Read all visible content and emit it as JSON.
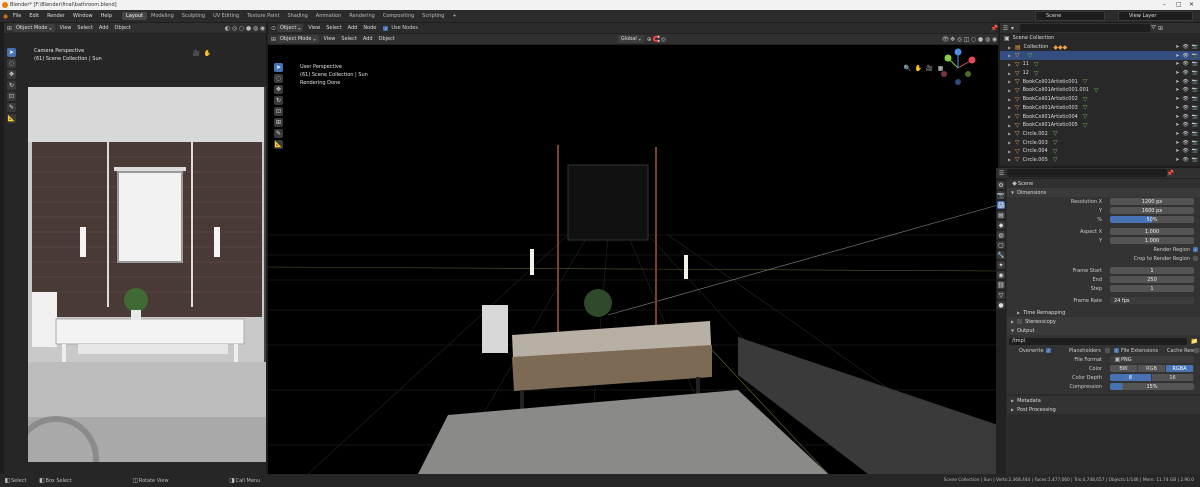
{
  "window": {
    "title": "Blender* [F:\\Blender\\final\\bathroom.blend]"
  },
  "menu": [
    "File",
    "Edit",
    "Render",
    "Window",
    "Help"
  ],
  "workspaces": [
    "Layout",
    "Modeling",
    "Sculpting",
    "UV Editing",
    "Texture Paint",
    "Shading",
    "Animation",
    "Rendering",
    "Compositing",
    "Scripting"
  ],
  "active_workspace": "Layout",
  "scene_selector": {
    "value": "Scene"
  },
  "view_layer_selector": {
    "value": "View Layer"
  },
  "left_view": {
    "mode": "Object Mode",
    "menus": [
      "View",
      "Select",
      "Add",
      "Object"
    ],
    "transform": "Global",
    "overlay_line1": "Camera Perspective",
    "overlay_line2": "(61) Scene Collection | Sun"
  },
  "main_view": {
    "mode": "Object Mode",
    "menus": [
      "View",
      "Select",
      "Add",
      "Object"
    ],
    "transform": "Global",
    "overlay_line1": "User Perspective",
    "overlay_line2": "(61) Scene Collection | Sun",
    "overlay_line3": "Rendering Done"
  },
  "node_header": {
    "object": "Object",
    "menus": [
      "View",
      "Select",
      "Add",
      "Node"
    ],
    "use_nodes": "Use Nodes"
  },
  "outliner": {
    "root": "Scene Collection",
    "rows": [
      {
        "label": "Collection",
        "type": "collection",
        "mat": false
      },
      {
        "label": "",
        "type": "mesh",
        "mat": true,
        "selected": true
      },
      {
        "label": "11",
        "type": "mesh",
        "mat": true
      },
      {
        "label": "12",
        "type": "mesh",
        "mat": true
      },
      {
        "label": "BookColl01Artistic001",
        "type": "mesh",
        "mat": true
      },
      {
        "label": "BookColl01Artistic001.001",
        "type": "mesh",
        "mat": true
      },
      {
        "label": "BookColl01Artistic002",
        "type": "mesh",
        "mat": true
      },
      {
        "label": "BookColl01Artistic003",
        "type": "mesh",
        "mat": true
      },
      {
        "label": "BookColl01Artistic004",
        "type": "mesh",
        "mat": true
      },
      {
        "label": "BookColl01Artistic005",
        "type": "mesh",
        "mat": true
      },
      {
        "label": "Circle.002",
        "type": "mesh",
        "mat": true
      },
      {
        "label": "Circle.003",
        "type": "mesh",
        "mat": true
      },
      {
        "label": "Circle.004",
        "type": "mesh",
        "mat": true
      },
      {
        "label": "Circle.005",
        "type": "mesh",
        "mat": true
      }
    ]
  },
  "properties": {
    "header": "Scene",
    "dimensions": {
      "title": "Dimensions",
      "resolution_x_label": "Resolution X",
      "resolution_x": "1200 px",
      "resolution_y_label": "Y",
      "resolution_y": "1600 px",
      "percent_label": "%",
      "percent": "50%",
      "percent_value": 50,
      "aspect_x_label": "Aspect X",
      "aspect_x": "1.000",
      "aspect_y_label": "Y",
      "aspect_y": "1.000",
      "render_region": "Render Region",
      "crop_region": "Crop to Render Region",
      "frame_start_label": "Frame Start",
      "frame_start": "1",
      "end_label": "End",
      "end": "250",
      "step_label": "Step",
      "step": "1",
      "frame_rate_label": "Frame Rate",
      "frame_rate": "24 fps"
    },
    "time_remapping": "Time Remapping",
    "stereoscopy": "Stereoscopy",
    "output": {
      "title": "Output",
      "path": "/tmp\\",
      "overwrite": "Overwrite",
      "placeholders": "Placeholders",
      "file_extensions": "File Extensions",
      "cache_result": "Cache Result",
      "file_format_label": "File Format",
      "file_format": "PNG",
      "color_label": "Color",
      "color_options": [
        "BW",
        "RGB",
        "RGBA"
      ],
      "color_active": "RGBA",
      "color_depth_label": "Color Depth",
      "color_depth_options": [
        "8",
        "16"
      ],
      "color_depth_active": "8",
      "compression_label": "Compression",
      "compression": "15%",
      "compression_value": 15
    },
    "metadata": "Metadata",
    "post_processing": "Post Processing"
  },
  "status": {
    "left": [
      "Select",
      "Box Select",
      "Rotate View",
      "Call Menu"
    ],
    "right": "Scene Collection | Sun | Verts:2,368,444 | Faces:1,477,060 | Tris:4,748,657 | Objects:1/146 | Mem: 11.74 GB | 2.90.0"
  }
}
